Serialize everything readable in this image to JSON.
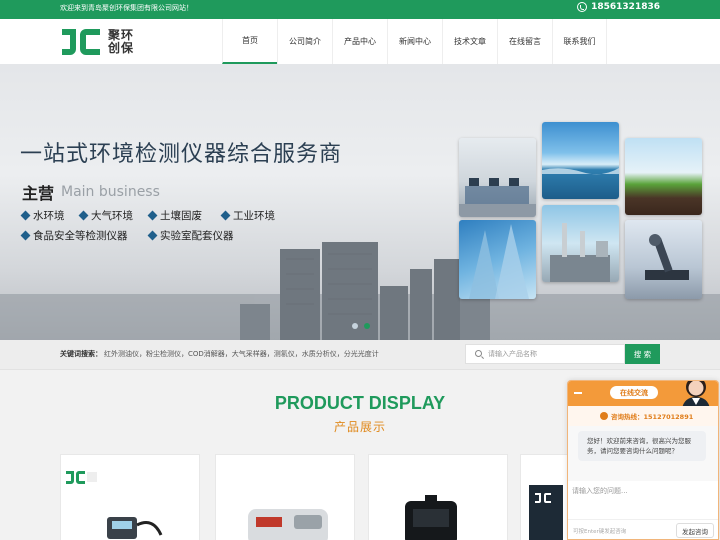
{
  "topbar": {
    "welcome": "欢迎来到青岛聚创环保集团有限公司网站！",
    "phone": "18561321836"
  },
  "brand": {
    "line1": "聚环",
    "line2": "创保",
    "color": "#1f9a5c"
  },
  "nav": [
    {
      "label": "首页",
      "active": true
    },
    {
      "label": "公司简介"
    },
    {
      "label": "产品中心"
    },
    {
      "label": "新闻中心"
    },
    {
      "label": "技术文章"
    },
    {
      "label": "在线留言"
    },
    {
      "label": "联系我们"
    }
  ],
  "banner": {
    "headline": "一站式环境检测仪器综合服务商",
    "main_business_cn": "主营",
    "main_business_en": "Main business",
    "items": [
      "水环境",
      "大气环境",
      "土壤固废",
      "工业环境",
      "食品安全等检测仪器",
      "实验室配套仪器"
    ]
  },
  "keywords": {
    "label": "关键词搜索：",
    "text": "红外测油仪，粉尘检测仪，COD消解器，大气采样器，测氡仪，水质分析仪，分光光度计"
  },
  "search": {
    "placeholder": "请输入产品名称",
    "button": "搜 索"
  },
  "products": {
    "title_en": "PRODUCT DISPLAY",
    "title_cn": "产品展示"
  },
  "chat": {
    "header": "在线交流",
    "hotline": "咨询热线：15127012891",
    "greeting": "您好！欢迎前来咨询，很高兴为您服务，请问您要咨询什么问题呢？",
    "input_placeholder": "请输入您的问题...",
    "hint": "可按Enter键发起咨询",
    "send": "发起咨询"
  }
}
